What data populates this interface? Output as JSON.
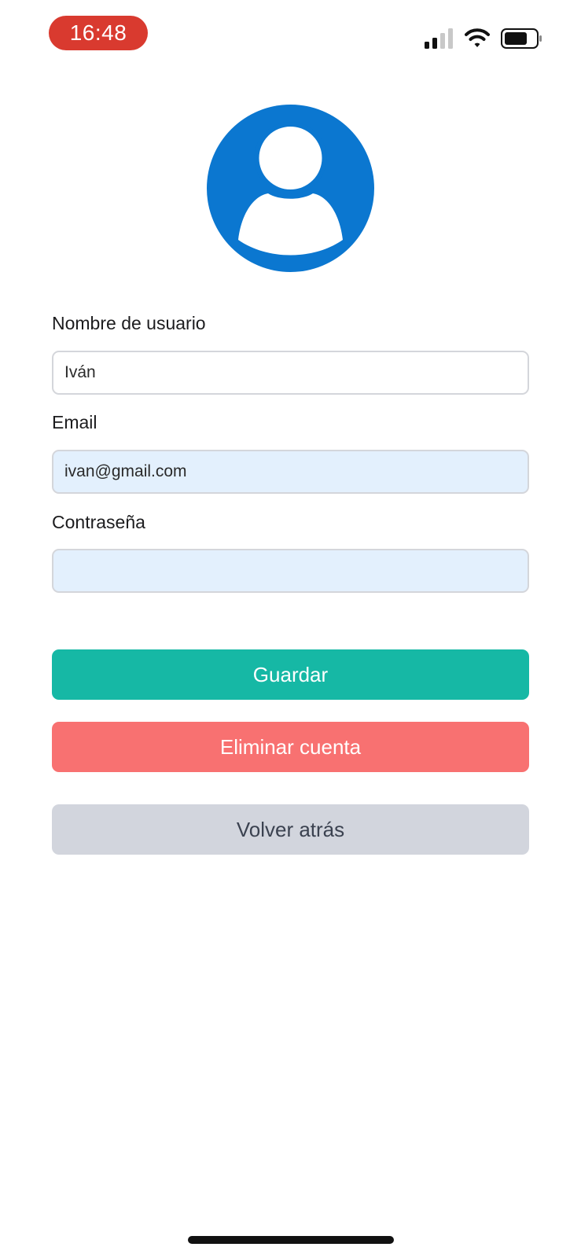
{
  "status_bar": {
    "time": "16:48",
    "time_pill_color": "#d93a2f",
    "signal_icon": "cellular-signal-icon",
    "wifi_icon": "wifi-icon",
    "battery_icon": "battery-icon"
  },
  "avatar": {
    "icon": "user-avatar-icon",
    "color": "#0b77d0"
  },
  "form": {
    "username": {
      "label": "Nombre de usuario",
      "value": "Iván"
    },
    "email": {
      "label": "Email",
      "value": "ivan@gmail.com"
    },
    "password": {
      "label": "Contraseña",
      "value": ""
    }
  },
  "buttons": {
    "save_label": "Guardar",
    "delete_label": "Eliminar cuenta",
    "back_label": "Volver atrás"
  },
  "colors": {
    "save": "#16b8a5",
    "delete": "#f87171",
    "back": "#d2d5dd",
    "input_tint": "#e3f0fd"
  }
}
